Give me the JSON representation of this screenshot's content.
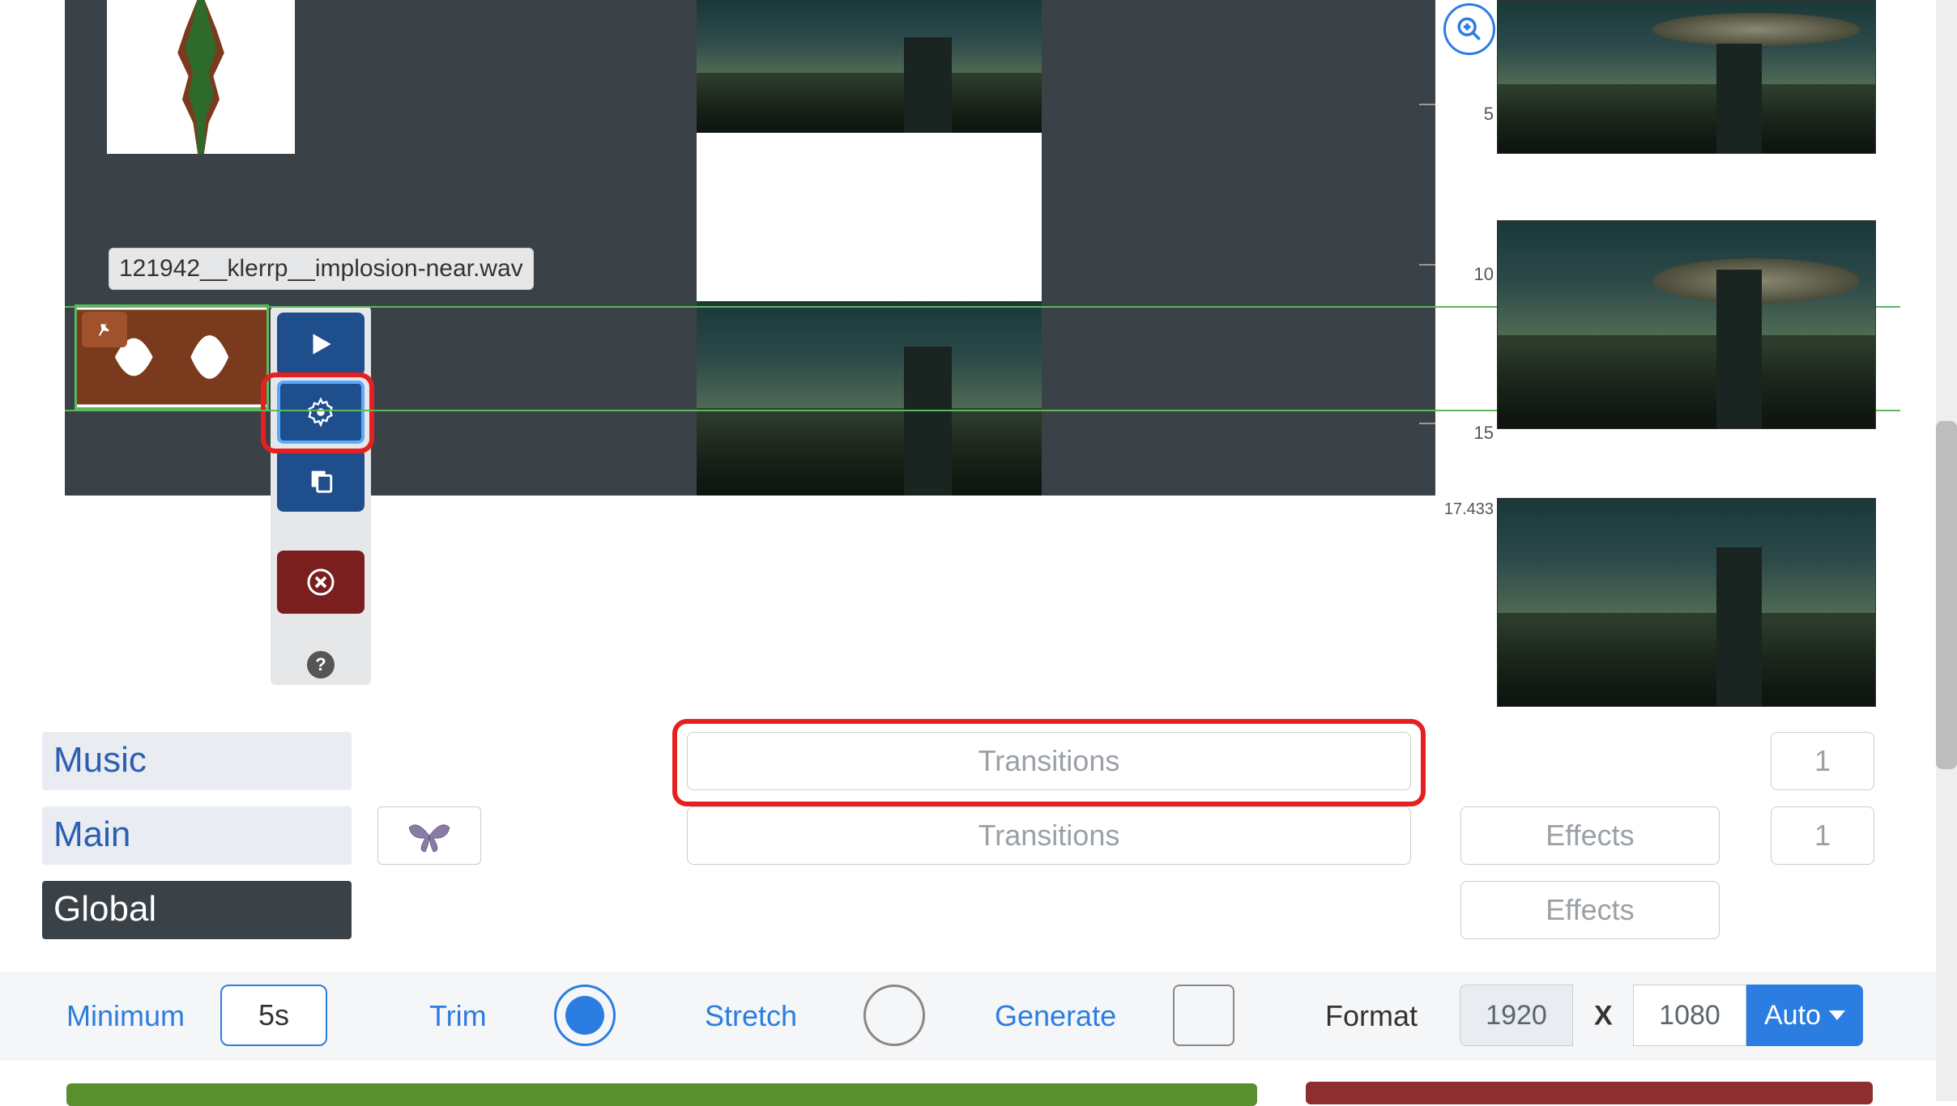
{
  "audio_clip": {
    "filename": "121942__klerrp__implosion-near.wav"
  },
  "clip_toolbar": {
    "play_label": "Play",
    "settings_label": "Settings",
    "duplicate_label": "Duplicate",
    "delete_label": "Delete",
    "help_label": "?"
  },
  "ruler": {
    "ticks": [
      "5",
      "10",
      "15",
      "17.433"
    ]
  },
  "tracks": [
    {
      "name": "Music"
    },
    {
      "name": "Main"
    },
    {
      "name": "Global"
    }
  ],
  "track_rows": {
    "music": {
      "transitions_label": "Transitions",
      "count": "1"
    },
    "main": {
      "transitions_label": "Transitions",
      "effects_label": "Effects",
      "count": "1"
    },
    "global": {
      "effects_label": "Effects"
    }
  },
  "bottom": {
    "minimum_label": "Minimum",
    "minimum_value": "5s",
    "trim_label": "Trim",
    "stretch_label": "Stretch",
    "generate_label": "Generate",
    "format_label": "Format",
    "width_value": "1920",
    "x_label": "X",
    "height_value": "1080",
    "auto_label": "Auto"
  },
  "toggles": {
    "trim": true,
    "stretch": false,
    "generate": false
  }
}
